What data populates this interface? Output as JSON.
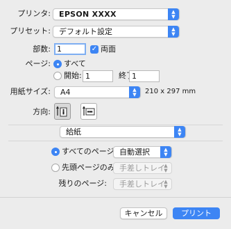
{
  "printer": {
    "label": "プリンタ:",
    "value": "EPSON XXXX"
  },
  "presets": {
    "label": "プリセット:",
    "value": "デフォルト設定"
  },
  "copies": {
    "label": "部数:",
    "value": "1",
    "duplex_label": "両面",
    "duplex_checked": true
  },
  "pages": {
    "label": "ページ:",
    "all_label": "すべて",
    "from_label": "開始:",
    "from_value": "1",
    "to_label": "終了:",
    "to_value": "1"
  },
  "paper_size": {
    "label": "用紙サイズ:",
    "value": "A4",
    "dimensions": "210 x 297 mm"
  },
  "orientation": {
    "label": "方向:",
    "options": [
      "portrait-icon",
      "landscape-icon"
    ],
    "selected": "portrait-icon"
  },
  "section": {
    "value": "給紙"
  },
  "paper_feed": {
    "all_pages_label": "すべてのページ:",
    "all_pages_value": "自動選択",
    "first_page_label": "先頭ページのみ:",
    "first_page_value": "手差しトレイ",
    "remaining_label": "残りのページ:",
    "remaining_value": "手差しトレイ"
  },
  "buttons": {
    "cancel": "キャンセル",
    "print": "プリント"
  },
  "colors": {
    "accent": "#3d85f4",
    "background": "#ececec"
  }
}
